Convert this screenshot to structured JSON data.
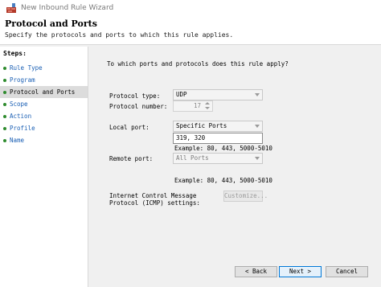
{
  "window": {
    "title": "New Inbound Rule Wizard",
    "icon": "firewall-icon"
  },
  "header": {
    "title": "Protocol and Ports",
    "subtitle": "Specify the protocols and ports to which this rule applies."
  },
  "steps": {
    "label": "Steps:",
    "items": [
      {
        "label": "Rule Type"
      },
      {
        "label": "Program"
      },
      {
        "label": "Protocol and Ports"
      },
      {
        "label": "Scope"
      },
      {
        "label": "Action"
      },
      {
        "label": "Profile"
      },
      {
        "label": "Name"
      }
    ]
  },
  "main": {
    "question": "To which ports and protocols does this rule apply?",
    "protocol_type": {
      "label": "Protocol type:",
      "value": "UDP"
    },
    "protocol_number": {
      "label": "Protocol number:",
      "value": "17"
    },
    "local_port": {
      "label": "Local port:",
      "select": "Specific Ports",
      "input": "319, 320",
      "example": "Example: 80, 443, 5000-5010"
    },
    "remote_port": {
      "label": "Remote port:",
      "select": "All Ports",
      "example": "Example: 80, 443, 5000-5010"
    },
    "icmp": {
      "label_line1": "Internet Control Message",
      "label_line2": "Protocol (ICMP) settings:",
      "button": "Customize..."
    }
  },
  "footer": {
    "back": "< Back",
    "next": "Next >",
    "cancel": "Cancel"
  },
  "colors": {
    "link": "#1a5fb4",
    "bullet": "#2e8b2e",
    "accent": "#0078d7"
  }
}
